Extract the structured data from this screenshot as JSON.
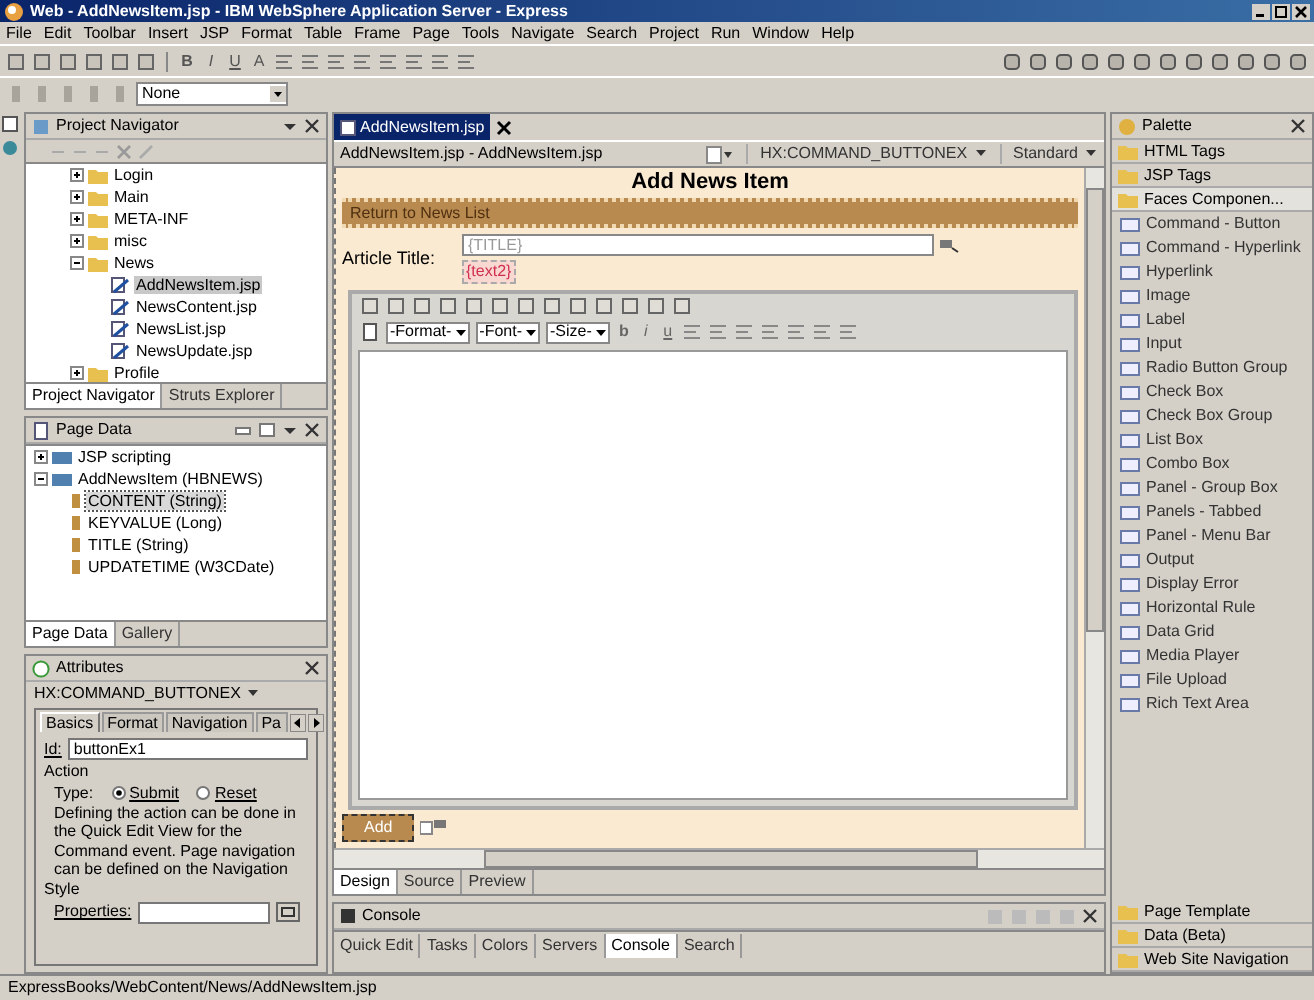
{
  "window": {
    "title": "Web - AddNewsItem.jsp - IBM WebSphere Application Server - Express"
  },
  "menu": [
    "File",
    "Edit",
    "Toolbar",
    "Insert",
    "JSP",
    "Format",
    "Table",
    "Frame",
    "Page",
    "Tools",
    "Navigate",
    "Search",
    "Project",
    "Run",
    "Window",
    "Help"
  ],
  "toolbar": {
    "format_letters": [
      "B",
      "I",
      "U",
      "A"
    ],
    "combo": "None"
  },
  "project_navigator": {
    "title": "Project Navigator",
    "tree": [
      {
        "label": "Login",
        "expanded": false
      },
      {
        "label": "Main",
        "expanded": false
      },
      {
        "label": "META-INF",
        "expanded": false
      },
      {
        "label": "misc",
        "expanded": false
      },
      {
        "label": "News",
        "expanded": true,
        "children": [
          {
            "label": "AddNewsItem.jsp",
            "selected": true
          },
          {
            "label": "NewsContent.jsp",
            "selected": false
          },
          {
            "label": "NewsList.jsp",
            "selected": false
          },
          {
            "label": "NewsUpdate.jsp",
            "selected": false
          }
        ]
      },
      {
        "label": "Profile",
        "expanded": false
      }
    ],
    "tabs": [
      {
        "label": "Project Navigator",
        "selected": true
      },
      {
        "label": "Struts Explorer",
        "selected": false
      }
    ]
  },
  "page_data": {
    "title": "Page Data",
    "tree": [
      {
        "label": "JSP scripting",
        "expanded": false
      },
      {
        "label": "AddNewsItem (HBNEWS)",
        "expanded": true,
        "children": [
          {
            "label": "CONTENT (String)",
            "selected": true
          },
          {
            "label": "KEYVALUE (Long)",
            "selected": false
          },
          {
            "label": "TITLE (String)",
            "selected": false
          },
          {
            "label": "UPDATETIME (W3CDate)",
            "selected": false
          }
        ]
      }
    ],
    "tabs": [
      {
        "label": "Page Data",
        "selected": true
      },
      {
        "label": "Gallery",
        "selected": false
      }
    ]
  },
  "attributes": {
    "title": "Attributes",
    "component": "HX:COMMAND_BUTTONEX",
    "tabs": [
      {
        "label": "Basics",
        "selected": true
      },
      {
        "label": "Format",
        "selected": false
      },
      {
        "label": "Navigation",
        "selected": false
      },
      {
        "label": "Pa",
        "selected": false
      }
    ],
    "id_label": "Id:",
    "id_value": "buttonEx1",
    "section": "Action",
    "type_label": "Type:",
    "radios": [
      {
        "label": "Submit",
        "selected": true
      },
      {
        "label": "Reset",
        "selected": false
      }
    ],
    "description": "Defining the action can be done in the Quick Edit View for the Command event. Page navigation can be defined on the Navigation",
    "style_label": "Style",
    "properties_label": "Properties:"
  },
  "editor": {
    "tab": "AddNewsItem.jsp",
    "breadcrumb": "AddNewsItem.jsp - AddNewsItem.jsp",
    "component": "HX:COMMAND_BUTTONEX",
    "style": "Standard",
    "heading": "Add News Item",
    "link": "Return to News List",
    "field_label": "Article Title:",
    "title_value": "{TITLE}",
    "error_tag": "{text2}",
    "rte_selects": [
      "-Format-",
      "-Font-",
      "-Size-"
    ],
    "rte_letters": [
      "b",
      "i",
      "u"
    ],
    "button": "Add",
    "view_tabs": [
      {
        "label": "Design",
        "selected": true
      },
      {
        "label": "Source",
        "selected": false
      },
      {
        "label": "Preview",
        "selected": false
      }
    ]
  },
  "console": {
    "title": "Console",
    "tabs": [
      {
        "label": "Quick Edit",
        "selected": false
      },
      {
        "label": "Tasks",
        "selected": false
      },
      {
        "label": "Colors",
        "selected": false
      },
      {
        "label": "Servers",
        "selected": false
      },
      {
        "label": "Console",
        "selected": true
      },
      {
        "label": "Search",
        "selected": false
      }
    ]
  },
  "palette": {
    "title": "Palette",
    "drawers": [
      {
        "label": "HTML Tags",
        "expanded": false
      },
      {
        "label": "JSP Tags",
        "expanded": false
      },
      {
        "label": "Faces Componen...",
        "expanded": true
      }
    ],
    "items": [
      "Command - Button",
      "Command - Hyperlink",
      "Hyperlink",
      "Image",
      "Label",
      "Input",
      "Radio Button Group",
      "Check Box",
      "Check Box Group",
      "List Box",
      "Combo Box",
      "Panel - Group Box",
      "Panels - Tabbed",
      "Panel - Menu Bar",
      "Output",
      "Display Error",
      "Horizontal Rule",
      "Data Grid",
      "Media Player",
      "File Upload",
      "Rich Text Area"
    ],
    "bottom_drawers": [
      {
        "label": "Page Template",
        "expanded": false
      },
      {
        "label": "Data (Beta)",
        "expanded": false
      },
      {
        "label": "Web Site Navigation",
        "expanded": false
      }
    ]
  },
  "status_bar": "ExpressBooks/WebContent/News/AddNewsItem.jsp"
}
